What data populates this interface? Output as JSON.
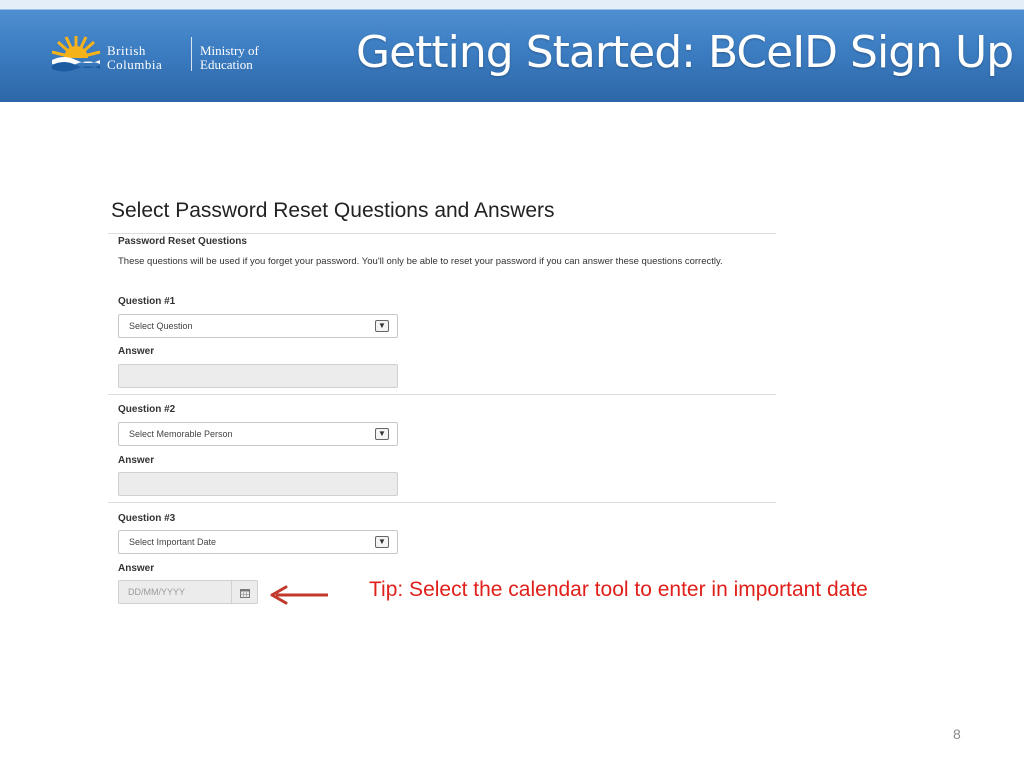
{
  "header": {
    "logo_line1": "British",
    "logo_line2": "Columbia",
    "ministry_line1": "Ministry of",
    "ministry_line2": "Education",
    "title": "Getting Started: BCeID Sign Up"
  },
  "section_heading": "Select Password Reset Questions and Answers",
  "form": {
    "title": "Password Reset Questions",
    "description": "These questions will be used if you forget your password. You'll only be able to reset your password if you can answer these questions correctly.",
    "questions": [
      {
        "label": "Question #1",
        "select_value": "Select Question",
        "answer_label": "Answer",
        "answer_value": ""
      },
      {
        "label": "Question #2",
        "select_value": "Select Memorable Person",
        "answer_label": "Answer",
        "answer_value": ""
      },
      {
        "label": "Question #3",
        "select_value": "Select Important Date",
        "answer_label": "Answer",
        "date_placeholder": "DD/MM/YYYY"
      }
    ]
  },
  "tip": "Tip: Select the calendar tool to enter in important date",
  "slide_number": "8",
  "colors": {
    "banner": "#3e7fc4",
    "tip": "#e0201b",
    "arrow": "#c0392b"
  },
  "icons": [
    "bc-sun-logo-icon",
    "chevron-down-icon",
    "calendar-icon",
    "left-arrow-icon"
  ]
}
